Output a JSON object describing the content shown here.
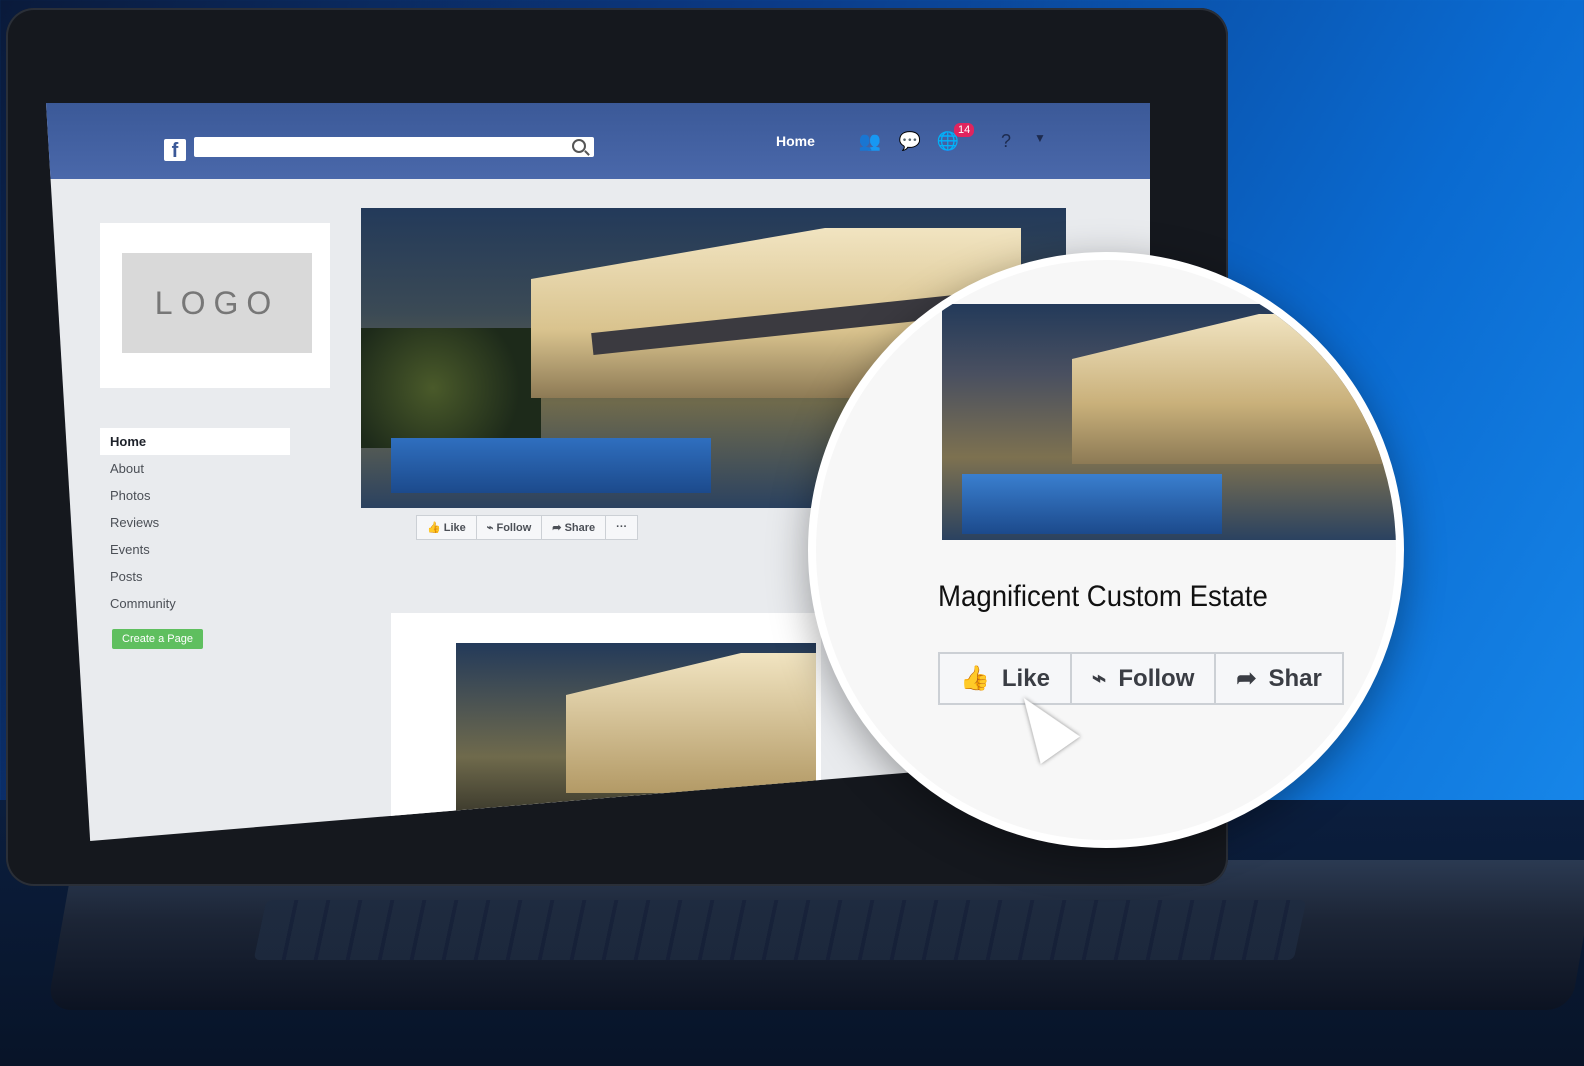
{
  "topbar": {
    "home_label": "Home",
    "notification_count": "14"
  },
  "sidebar": {
    "logo_text": "LOGO",
    "items": [
      {
        "label": "Home"
      },
      {
        "label": "About"
      },
      {
        "label": "Photos"
      },
      {
        "label": "Reviews"
      },
      {
        "label": "Events"
      },
      {
        "label": "Posts"
      },
      {
        "label": "Community"
      }
    ],
    "create_page_label": "Create a Page"
  },
  "actions": {
    "like": "Like",
    "follow": "Follow",
    "share": "Share",
    "more": "···"
  },
  "magnified": {
    "title": "Magnificent Custom Estate",
    "like": "Like",
    "follow": "Follow",
    "share": "Shar"
  }
}
